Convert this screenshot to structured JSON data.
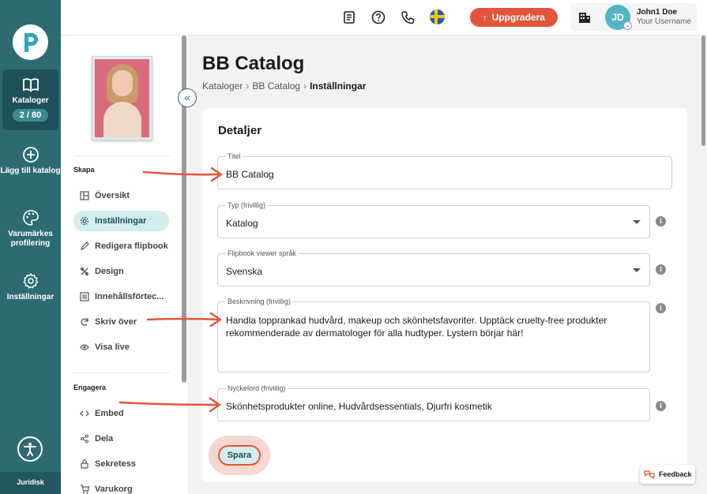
{
  "rail": {
    "items": [
      {
        "label": "Kataloger",
        "badge": "2 / 80",
        "icon": "book-icon"
      },
      {
        "label": "Lägg till katalog",
        "icon": "add-circle-icon"
      },
      {
        "label": "Varumärkes profilering",
        "icon": "palette-icon"
      },
      {
        "label": "Inställningar",
        "icon": "gear-icon"
      }
    ],
    "footer": "Juridisk"
  },
  "topbar": {
    "upgrade_label": "Uppgradera",
    "user_initials": "JD",
    "user_name": "John1 Doe",
    "user_sub": "Your Username"
  },
  "subside": {
    "section1": "Skapa",
    "section2": "Engagera",
    "items": [
      {
        "label": "Översikt"
      },
      {
        "label": "Inställningar"
      },
      {
        "label": "Redigera flipbook"
      },
      {
        "label": "Design"
      },
      {
        "label": "Innehållsförtec..."
      },
      {
        "label": "Skriv över"
      },
      {
        "label": "Visa live"
      },
      {
        "label": "Embed"
      },
      {
        "label": "Dela"
      },
      {
        "label": "Sekretess"
      },
      {
        "label": "Varukorg"
      }
    ]
  },
  "page": {
    "title": "BB Catalog",
    "breadcrumb": [
      "Kataloger",
      "BB Catalog",
      "Inställningar"
    ]
  },
  "details": {
    "heading": "Detaljer",
    "title_label": "Titel",
    "title_value": "BB Catalog",
    "type_label": "Typ (frivillig)",
    "type_value": "Katalog",
    "lang_label": "Flipbook viewer språk",
    "lang_value": "Svenska",
    "desc_label": "Beskrivning (frivillig)",
    "desc_value": "Handla topprankad hudvård, makeup och skönhetsfavoriter. Upptäck cruelty-free produkter rekommenderade av dermatologer för alla hudtyper. Lystern börjar här!",
    "keywords_label": "Nyckelord (frivillig)",
    "keywords_value": "Skönhetsprodukter online, Hudvårdsessentials, Djurfri kosmetik",
    "save_label": "Spara"
  },
  "feedback_label": "Feedback",
  "colors": {
    "rail": "#2e6b71",
    "accent": "#e2553b",
    "active_bg": "#d3ecee"
  }
}
